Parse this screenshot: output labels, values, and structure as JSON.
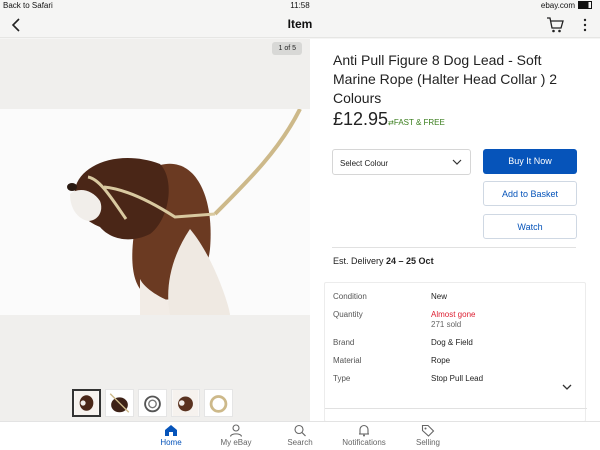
{
  "status_bar": {
    "back_label": "Back to Safari",
    "time": "11:58",
    "site": "ebay.com"
  },
  "nav": {
    "title": "Item"
  },
  "gallery": {
    "counter": "1 of 5"
  },
  "item": {
    "title": "Anti Pull Figure 8 Dog Lead - Soft Marine Rope (Halter Head Collar ) 2 Colours",
    "price": "£12.95",
    "shipping": "FAST & FREE"
  },
  "select": {
    "value": "Select Colour"
  },
  "buttons": {
    "buy": "Buy It Now",
    "basket": "Add to Basket",
    "watch": "Watch"
  },
  "delivery": {
    "label": "Est. Delivery",
    "dates": "24 – 25 Oct"
  },
  "specs": [
    {
      "key": "Condition",
      "value": "New"
    },
    {
      "key": "Quantity",
      "value": "Almost gone",
      "sub": "271 sold"
    },
    {
      "key": "Brand",
      "value": "Dog & Field"
    },
    {
      "key": "Material",
      "value": "Rope"
    },
    {
      "key": "Type",
      "value": "Stop Pull Lead"
    }
  ],
  "tabs": [
    {
      "label": "Home",
      "icon": "home-icon",
      "active": true
    },
    {
      "label": "My eBay",
      "icon": "person-icon"
    },
    {
      "label": "Search",
      "icon": "search-icon"
    },
    {
      "label": "Notifications",
      "icon": "bell-icon"
    },
    {
      "label": "Selling",
      "icon": "tag-icon"
    }
  ],
  "colors": {
    "accent": "#0654ba",
    "shipping_green": "#3a7d1c",
    "warning_red": "#dd1e31"
  }
}
